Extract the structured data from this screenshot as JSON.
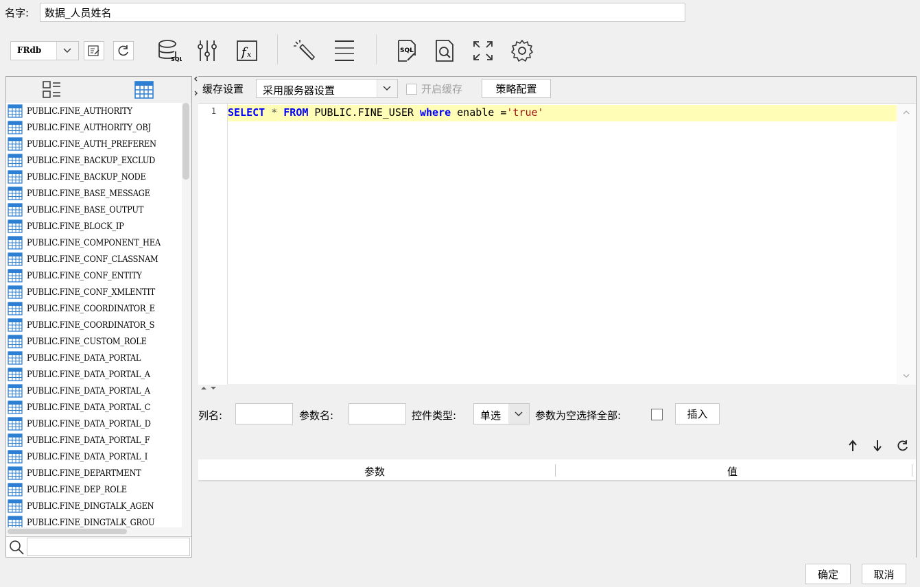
{
  "name_field": {
    "label": "名字:",
    "value": "数据_人员姓名"
  },
  "toolbar": {
    "datasource": "FRdb",
    "icons": [
      "edit-connection-icon",
      "refresh-icon",
      "database-sql-icon",
      "sliders-icon",
      "formula-icon",
      "magic-wand-icon",
      "column-width-icon",
      "sql-file-icon",
      "preview-icon",
      "fullscreen-icon",
      "gear-icon"
    ]
  },
  "left_panel": {
    "tables": [
      "PUBLIC.FINE_AUTHORITY",
      "PUBLIC.FINE_AUTHORITY_OBJ",
      "PUBLIC.FINE_AUTH_PREFEREN",
      "PUBLIC.FINE_BACKUP_EXCLUD",
      "PUBLIC.FINE_BACKUP_NODE",
      "PUBLIC.FINE_BASE_MESSAGE",
      "PUBLIC.FINE_BASE_OUTPUT",
      "PUBLIC.FINE_BLOCK_IP",
      "PUBLIC.FINE_COMPONENT_HEA",
      "PUBLIC.FINE_CONF_CLASSNAM",
      "PUBLIC.FINE_CONF_ENTITY",
      "PUBLIC.FINE_CONF_XMLENTIT",
      "PUBLIC.FINE_COORDINATOR_E",
      "PUBLIC.FINE_COORDINATOR_S",
      "PUBLIC.FINE_CUSTOM_ROLE",
      "PUBLIC.FINE_DATA_PORTAL",
      "PUBLIC.FINE_DATA_PORTAL_A",
      "PUBLIC.FINE_DATA_PORTAL_A",
      "PUBLIC.FINE_DATA_PORTAL_C",
      "PUBLIC.FINE_DATA_PORTAL_D",
      "PUBLIC.FINE_DATA_PORTAL_F",
      "PUBLIC.FINE_DATA_PORTAL_I",
      "PUBLIC.FINE_DEPARTMENT",
      "PUBLIC.FINE_DEP_ROLE",
      "PUBLIC.FINE_DINGTALK_AGEN",
      "PUBLIC.FINE_DINGTALK_GROU"
    ]
  },
  "cache": {
    "label": "缓存设置",
    "mode": "采用服务器设置",
    "enable_label": "开启缓存",
    "strategy_button": "策略配置"
  },
  "editor": {
    "line_number": "1",
    "kw_select": "SELECT",
    "star": " * ",
    "kw_from": "FROM",
    "table": " PUBLIC.FINE_USER ",
    "kw_where": "where",
    "cond": " enable =",
    "literal": "'true'"
  },
  "params": {
    "column_label": "列名:",
    "param_name_label": "参数名:",
    "control_type_label": "控件类型:",
    "control_type_value": "单选",
    "empty_select_all_label": "参数为空选择全部:",
    "insert_button": "插入"
  },
  "param_table": {
    "columns": [
      "参数",
      "值"
    ]
  },
  "footer": {
    "ok": "确定",
    "cancel": "取消"
  }
}
